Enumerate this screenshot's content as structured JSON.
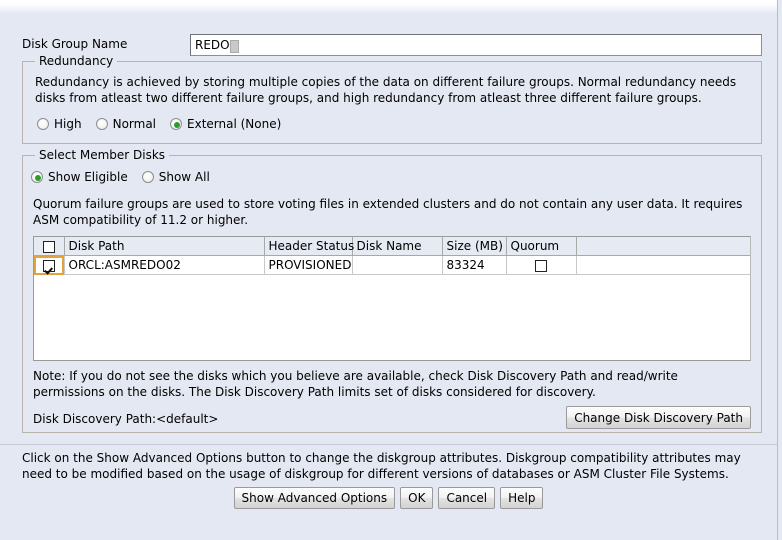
{
  "dialog": {
    "disk_group_name_label": "Disk Group Name",
    "disk_group_name_value": "REDO"
  },
  "redundancy": {
    "title": "Redundancy",
    "description": "Redundancy is achieved by storing multiple copies of the data on different failure groups. Normal redundancy needs disks from atleast two different failure groups, and high redundancy from atleast three different failure groups.",
    "options": [
      {
        "label": "High",
        "selected": false
      },
      {
        "label": "Normal",
        "selected": false
      },
      {
        "label": "External (None)",
        "selected": true
      }
    ]
  },
  "member_disks": {
    "title": "Select Member Disks",
    "filter_options": [
      {
        "label": "Show Eligible",
        "selected": true
      },
      {
        "label": "Show All",
        "selected": false
      }
    ],
    "quorum_description": "Quorum failure groups are used to store voting files in extended clusters and do not contain any user data. It requires ASM compatibility of 11.2 or higher.",
    "table": {
      "columns": [
        "",
        "Disk Path",
        "Header Status",
        "Disk Name",
        "Size (MB)",
        "Quorum"
      ],
      "header_select_all_checked": false,
      "rows": [
        {
          "selected": true,
          "disk_path": "ORCL:ASMREDO02",
          "header_status": "PROVISIONED",
          "disk_name": "",
          "size_mb": "83324",
          "quorum": false
        }
      ]
    },
    "note": "Note: If you do not see the disks which you believe are available, check Disk Discovery Path and read/write permissions on the disks. The Disk Discovery Path limits set of disks considered for discovery.",
    "disk_discovery_path_label": "Disk Discovery Path:<default>",
    "change_disk_discovery_path_button": "Change Disk Discovery Path"
  },
  "footer": {
    "description": "Click on the Show Advanced Options button to change the diskgroup attributes. Diskgroup compatibility attributes may need to be modified based on the usage of diskgroup for different versions of databases or ASM Cluster File Systems.",
    "buttons": [
      {
        "label": "Show Advanced Options",
        "name": "show-advanced-options-button"
      },
      {
        "label": "OK",
        "name": "ok-button"
      },
      {
        "label": "Cancel",
        "name": "cancel-button"
      },
      {
        "label": "Help",
        "name": "help-button"
      }
    ]
  },
  "colors": {
    "background": "#e4e8f2",
    "accent_selected_radio": "#2d9c2d",
    "focus_border": "#e2a33c"
  }
}
